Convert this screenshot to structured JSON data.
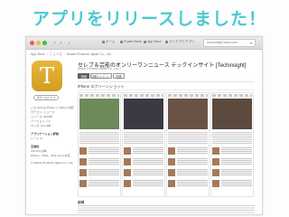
{
  "banner": {
    "text": "アプリをリリースしました！"
  },
  "titlebar": {
    "tabs": [
      "ホーム",
      "iTunes Store",
      "App Store",
      "マイアプリ",
      "アプリ"
    ],
    "account": "Account@iCloud.com"
  },
  "breadcrumb": [
    "App Store",
    "ニュース",
    "Mobile Products Japan Co., Ltd."
  ],
  "app": {
    "icon_letter": "T",
    "title": "セレブ＆芸能のオンリーワンニュース テックインサイト [Techinsight]",
    "seller": "Mobile Products Japan Co., Ltd. >",
    "get_label": "ダウンロード",
    "tabs": [
      "詳細",
      "評価とレビュー",
      "関連"
    ]
  },
  "sidebar": {
    "lines": [
      "この App は iPhone と iPad に対応",
      "カテゴリ: ニュース",
      "リリース: 2015年",
      "バージョン: 1.0",
      "サイズ: 10.0 MB"
    ],
    "heading1": "アプリケーション評価",
    "line1": "レート 4+",
    "heading2": "互換性",
    "line2": "iOS 8.0 以降",
    "line3": "iPhone、iPad、iPod touch 対応",
    "copyright": "© Mobile Products Japan Co., Ltd."
  },
  "screenshots": {
    "title": "iPhone スクリーンショット",
    "heroes": [
      "#6d8a5a",
      "#3b3a44",
      "#6a5246",
      "#5c4a3e"
    ]
  },
  "description": {
    "heading": "説明"
  },
  "colors": {
    "accent": "#4cc9cf",
    "icon": "#dfa92e",
    "active_tab": "#5e5e5e"
  }
}
